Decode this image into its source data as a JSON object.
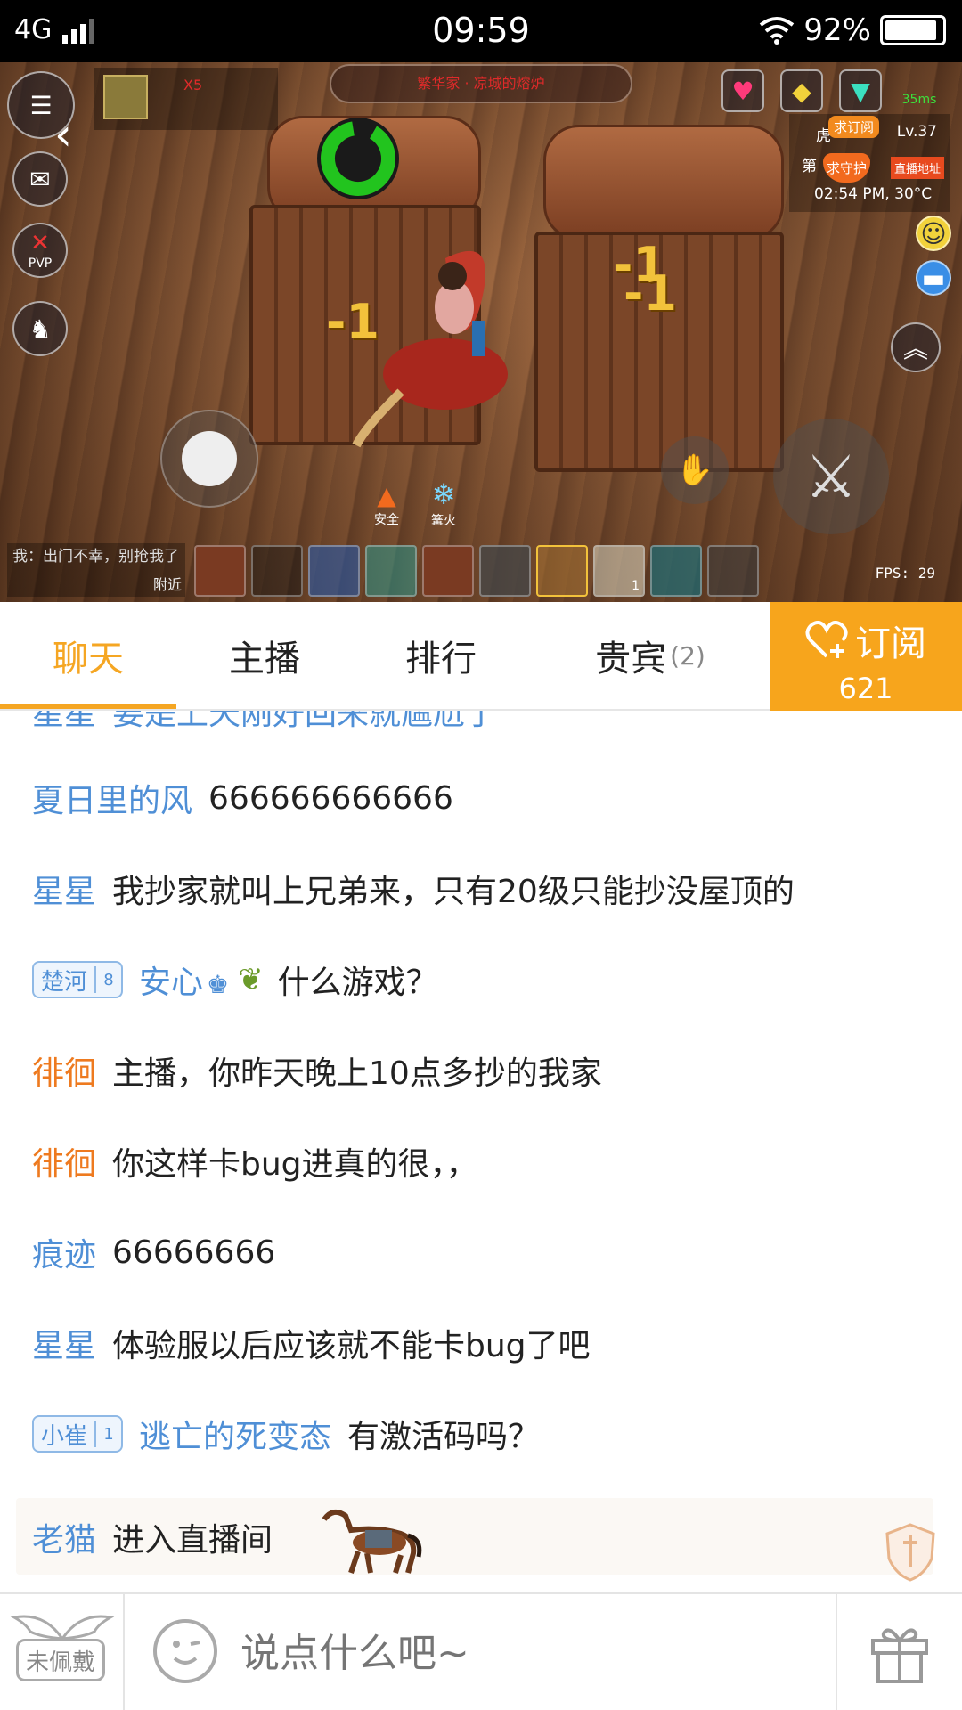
{
  "statusbar": {
    "network": "4G",
    "time": "09:59",
    "battery": "92%",
    "battery_level": 0.92
  },
  "game": {
    "banner": "繁华家 · 凉城的熔炉",
    "damage": [
      "-1",
      "-1",
      "-1"
    ],
    "resource_count": "X5",
    "stat_top": "Lv.37",
    "stat_name": "虎",
    "stat_prefix": "第",
    "clock": "02:54 PM, 30°C",
    "ping": "35ms",
    "tag1": "求订阅",
    "tag2": "求守护",
    "tag3": "直播地址",
    "pvp": "PVP",
    "status_safe": "安全",
    "status_fire": "篝火",
    "fps": "FPS: 29",
    "minichat": "我：出门不幸，别抢我了",
    "nearby": "附近",
    "slot_count": "1"
  },
  "tabs": {
    "chat": "聊天",
    "anchor": "主播",
    "rank": "排行",
    "vip": "贵宾",
    "vip_count": "(2)",
    "subscribe_label": "订阅",
    "subscribe_count": "621"
  },
  "chat": {
    "cut_nick": "星星",
    "cut_text": "要是上天刚好回来就尴尬了",
    "messages": [
      {
        "nick": "夏日里的风",
        "text": "666666666666"
      },
      {
        "nick": "星星",
        "text": "我抄家就叫上兄弟来，只有20级只能抄没屋顶的"
      },
      {
        "badge": "楚河",
        "badge_level": "8",
        "nick": "安心",
        "text": "什么游戏？"
      },
      {
        "nick": "徘徊",
        "text": "主播，你昨天晚上10点多抄的我家"
      },
      {
        "nick": "徘徊",
        "text": "你这样卡bug进真的很，，"
      },
      {
        "nick": "痕迹",
        "text": "66666666"
      },
      {
        "nick": "星星",
        "text": "体验服以后应该就不能卡bug了吧"
      },
      {
        "badge": "小崔",
        "badge_level": "1",
        "nick": "逃亡的死变态",
        "text": "有激活码吗？"
      }
    ],
    "enter": {
      "nick": "老猫",
      "text": "进入直播间"
    }
  },
  "bottom": {
    "wear_label": "未佩戴",
    "placeholder": "说点什么吧~"
  },
  "colors": {
    "accent": "#f5a623",
    "nick_blue": "#4f8fd6",
    "nick_orange": "#ee7a1f"
  }
}
